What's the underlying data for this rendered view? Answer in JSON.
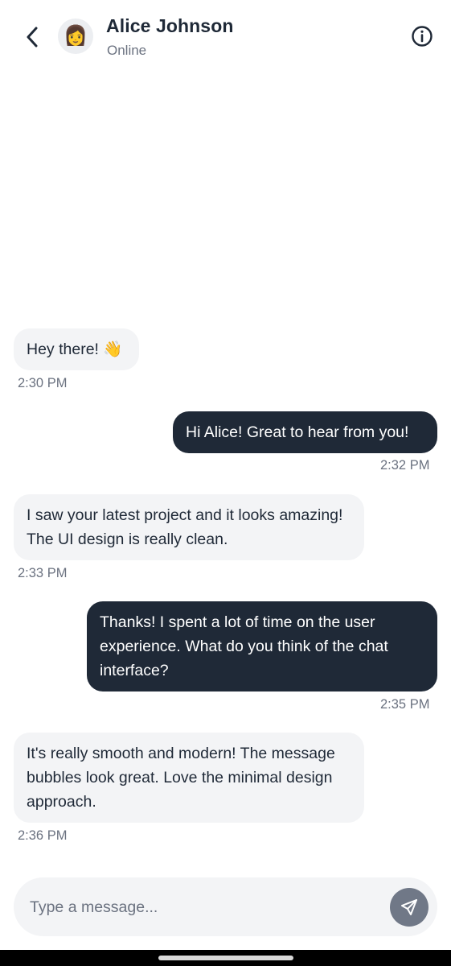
{
  "header": {
    "contact_name": "Alice Johnson",
    "contact_status": "Online",
    "avatar_emoji": "👩",
    "back_icon": "chevron-left-icon",
    "info_icon": "info-circle-icon"
  },
  "messages": [
    {
      "direction": "incoming",
      "text": "Hey there! 👋",
      "time": "2:30 PM"
    },
    {
      "direction": "outgoing",
      "text": "Hi Alice! Great to hear from you!",
      "time": "2:32 PM"
    },
    {
      "direction": "incoming",
      "text": "I saw your latest project and it looks amazing! The UI design is really clean.",
      "time": "2:33 PM"
    },
    {
      "direction": "outgoing",
      "text": "Thanks! I spent a lot of time on the user experience. What do you think of the chat interface?",
      "time": "2:35 PM"
    },
    {
      "direction": "incoming",
      "text": "It's really smooth and modern! The message bubbles look great. Love the minimal design approach.",
      "time": "2:36 PM"
    }
  ],
  "composer": {
    "placeholder": "Type a message...",
    "value": "",
    "send_icon": "send-icon"
  },
  "colors": {
    "incoming_bubble": "#f3f4f6",
    "outgoing_bubble": "#1f2937",
    "send_button": "#707887",
    "muted_text": "#6b7280"
  }
}
